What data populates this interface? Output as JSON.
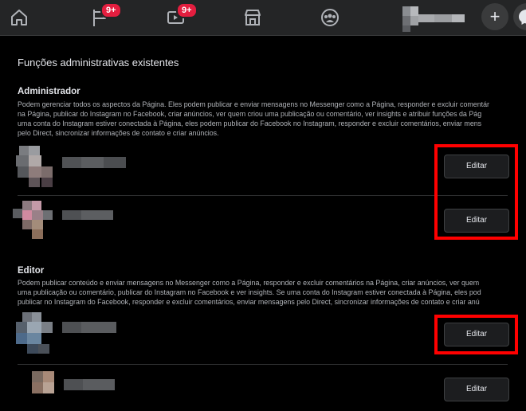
{
  "nav": {
    "home_icon": "home-icon",
    "pages_badge": "9+",
    "watch_badge": "9+",
    "plus_label": "+"
  },
  "section_title": "Funções administrativas existentes",
  "roles": [
    {
      "title": "Administrador",
      "description": [
        "Podem gerenciar todos os aspectos da Página. Eles podem publicar e enviar mensagens no Messenger como a Página, responder e excluir comentár",
        "na Página, publicar do Instagram no Facebook, criar anúncios, ver quem criou uma publicação ou comentário, ver insights e atribuir funções da Pág",
        "uma conta do Instagram estiver conectada à Página, eles podem publicar do Facebook no Instagram, responder e excluir comentários, enviar mens",
        "pelo Direct, sincronizar informações de contato e criar anúncios."
      ]
    },
    {
      "title": "Editor",
      "description": [
        "Podem publicar conteúdo e enviar mensagens no Messenger como a Página, responder e excluir comentários na Página, criar anúncios, ver quem",
        "uma publicação ou comentário, publicar do Instagram no Facebook e ver insights. Se uma conta do Instagram estiver conectada à Página, eles pod",
        "publicar no Instagram do Facebook, responder e excluir comentários, enviar mensagens pelo Direct, sincronizar informações de contato e criar anú"
      ]
    }
  ],
  "edit_label": "Editar",
  "colors": {
    "background": "#000000",
    "topbar": "#242526",
    "badge": "#e41e3f",
    "highlight": "#ff0000"
  }
}
